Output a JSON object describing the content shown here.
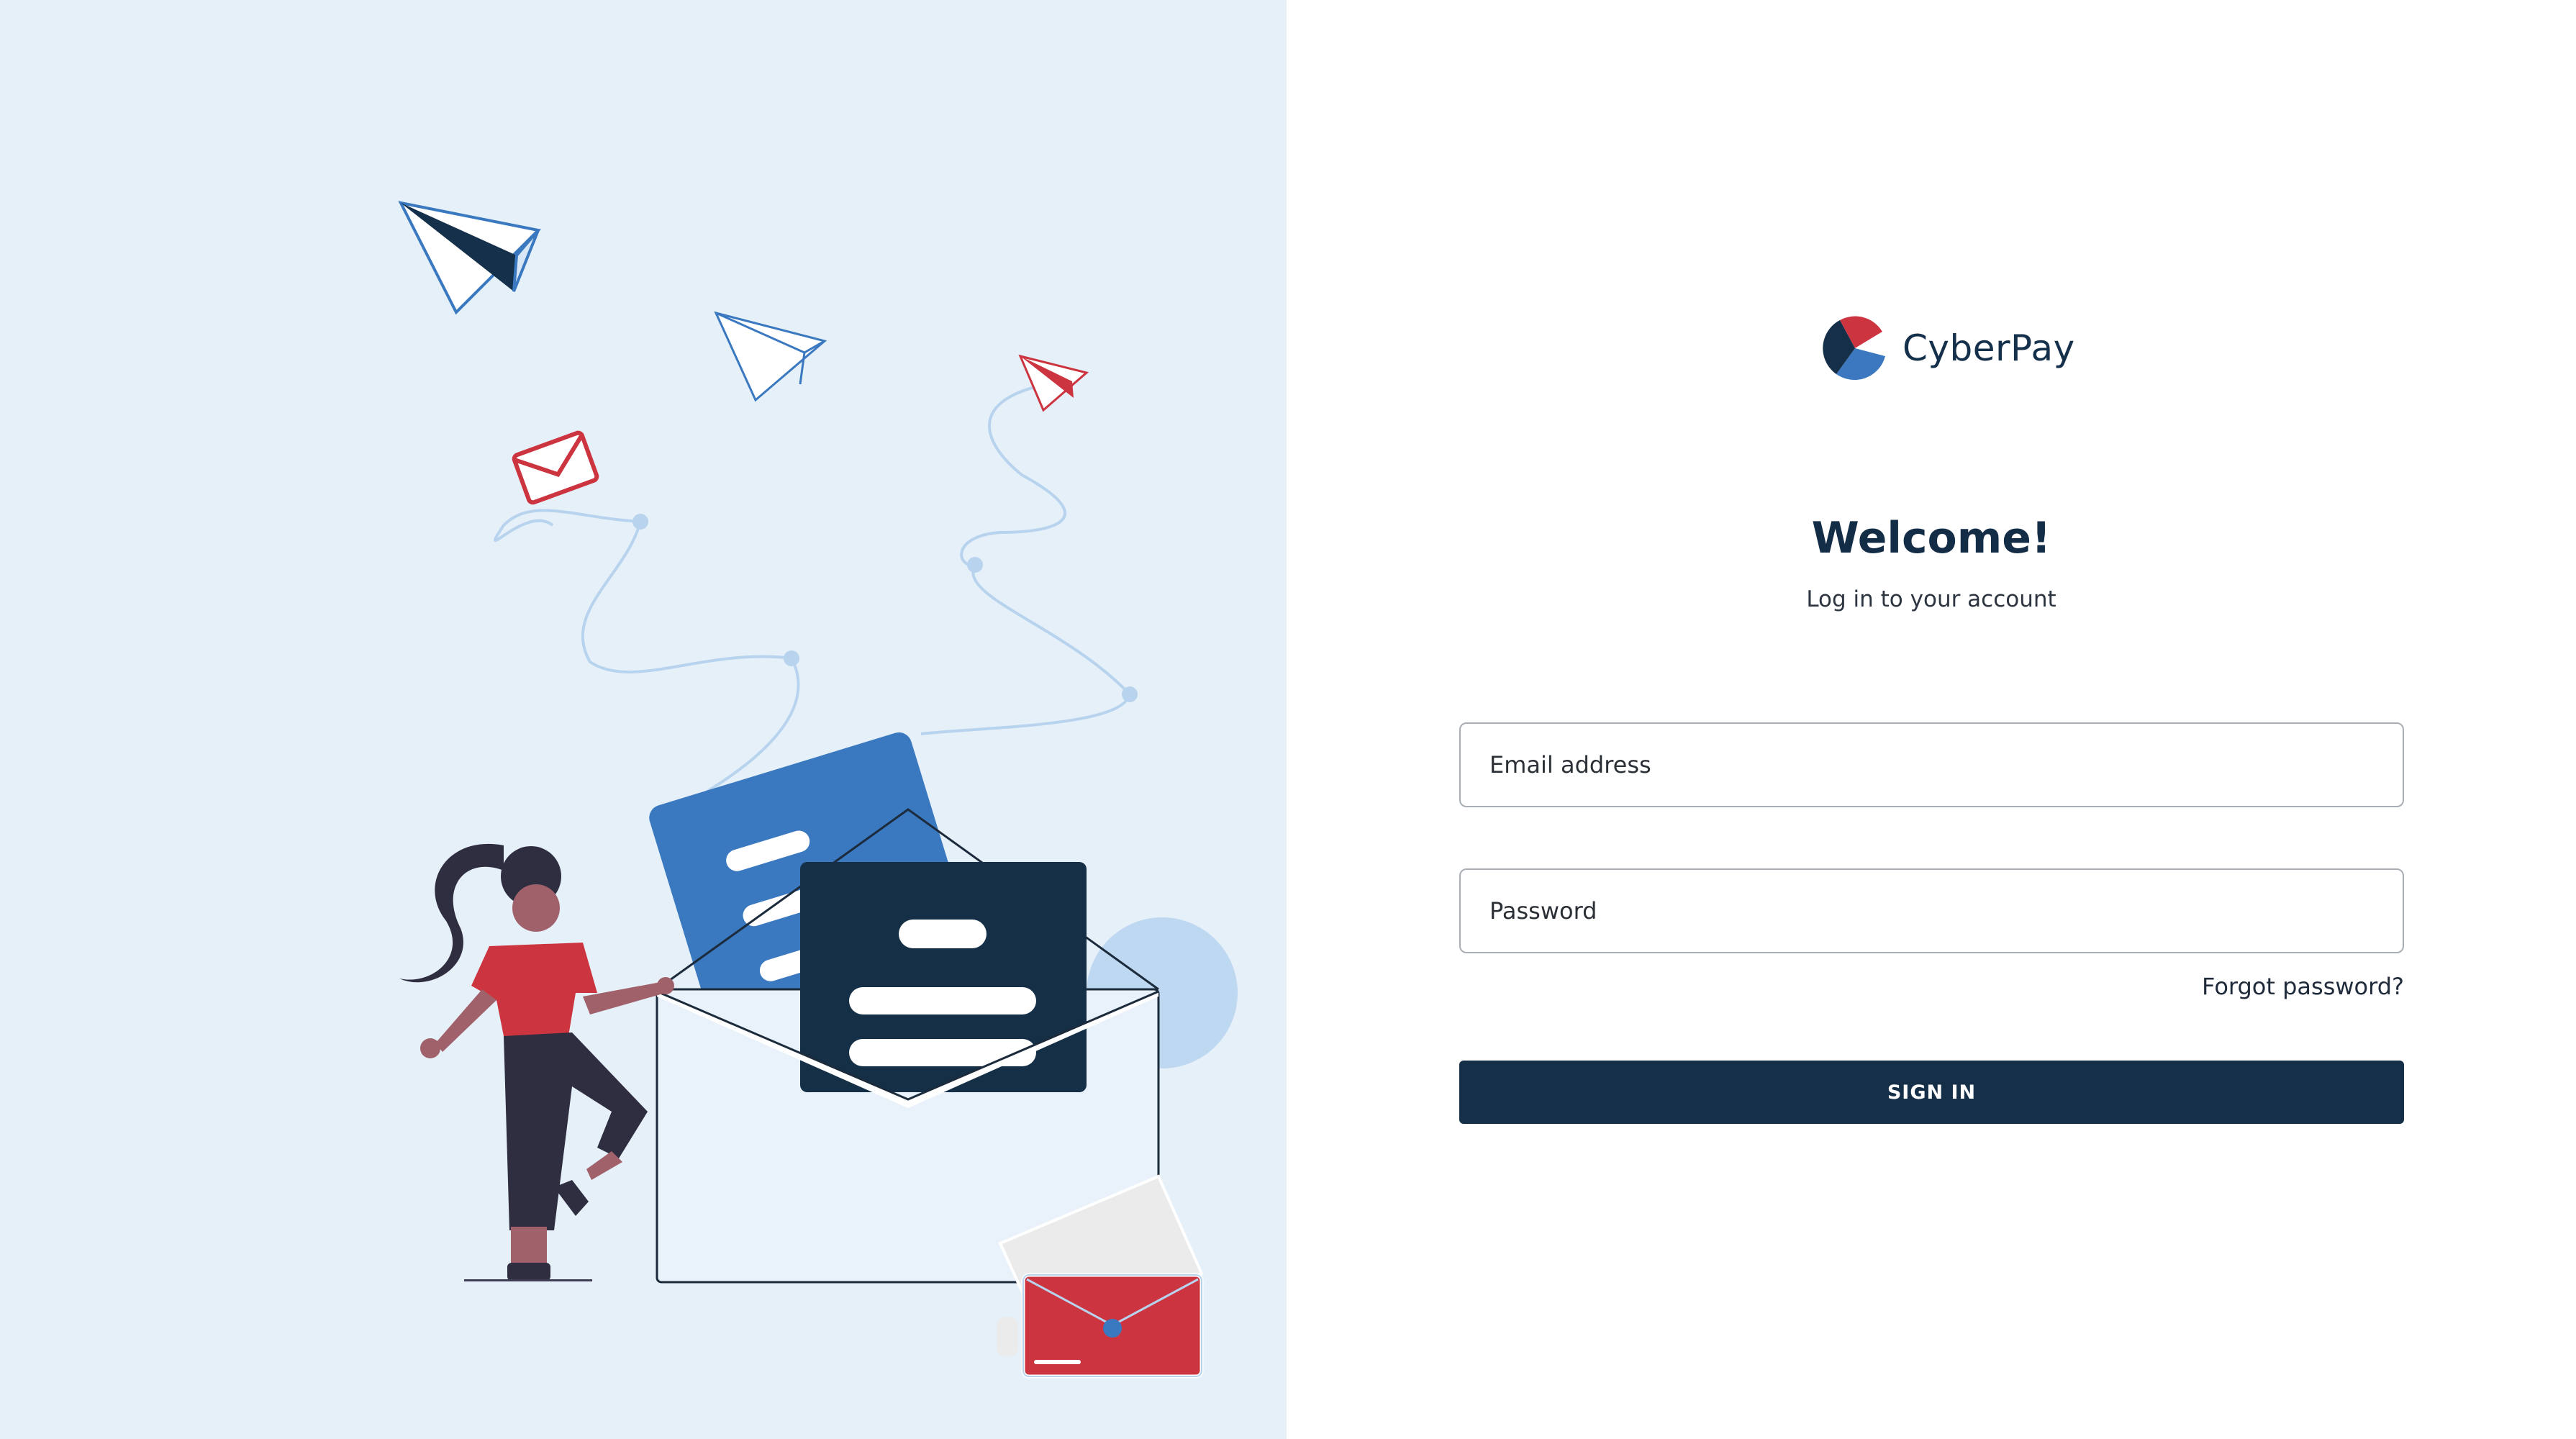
{
  "brand": {
    "name": "CyberPay",
    "colors": {
      "navy": "#142f47",
      "red": "#cc3540",
      "blue": "#3c78c0",
      "panel": "#e6f0f9"
    }
  },
  "login": {
    "heading": "Welcome!",
    "subheading": "Log in to your account",
    "email_placeholder": "Email address",
    "password_placeholder": "Password",
    "forgot_label": "Forgot password?",
    "signin_label": "SIGN IN"
  },
  "illustration": {
    "icons": [
      "paper-plane-icon",
      "envelope-icon",
      "letter-icon",
      "woman-figure"
    ]
  }
}
